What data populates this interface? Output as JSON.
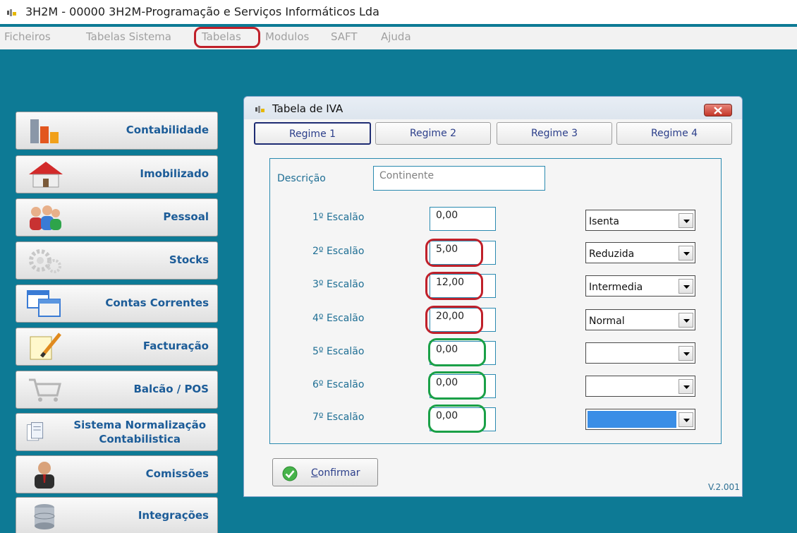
{
  "window": {
    "title": "3H2M  -  00000  3H2M-Programação e Serviços Informáticos Lda"
  },
  "menu": {
    "items": [
      "Ficheiros",
      "Tabelas Sistema",
      "Tabelas",
      "Modulos",
      "SAFT",
      "Ajuda"
    ]
  },
  "sidebar": {
    "items": [
      {
        "label": "Contabilidade",
        "icon": "chart-icon"
      },
      {
        "label": "Imobilizado",
        "icon": "house-icon"
      },
      {
        "label": "Pessoal",
        "icon": "people-icon"
      },
      {
        "label": "Stocks",
        "icon": "gears-icon"
      },
      {
        "label": "Contas Correntes",
        "icon": "windows-icon"
      },
      {
        "label": "Facturação",
        "icon": "pencil-note-icon"
      },
      {
        "label": "Balcão / POS",
        "icon": "cart-icon"
      },
      {
        "label_line1": "Sistema Normalização",
        "label_line2": "Contabilistica",
        "icon": "documents-icon"
      },
      {
        "label": "Comissões",
        "icon": "businessman-icon"
      },
      {
        "label": "Integrações",
        "icon": "database-icon"
      }
    ]
  },
  "dialog": {
    "title": "Tabela de IVA",
    "tabs": [
      "Regime 1",
      "Regime 2",
      "Regime 3",
      "Regime 4"
    ],
    "active_tab": "Regime 1",
    "description_label": "Descrição",
    "description_value": "Continente",
    "rows": [
      {
        "label": "1º Escalão",
        "value": "0,00",
        "type": "Isenta"
      },
      {
        "label": "2º Escalão",
        "value": "5,00",
        "type": "Reduzida"
      },
      {
        "label": "3º Escalão",
        "value": "12,00",
        "type": "Intermedia"
      },
      {
        "label": "4º Escalão",
        "value": "20,00",
        "type": "Normal"
      },
      {
        "label": "5º Escalão",
        "value": "0,00",
        "type": ""
      },
      {
        "label": "6º Escalão",
        "value": "0,00",
        "type": ""
      },
      {
        "label": "7º Escalão",
        "value": "0,00",
        "type": ""
      }
    ],
    "confirm_first": "C",
    "confirm_rest": "onfirmar",
    "version": "V.2.001"
  },
  "colors": {
    "desktop": "#0d7a95",
    "highlight_red": "#c0202a",
    "highlight_green": "#1aa047",
    "label_blue": "#1e6e94"
  }
}
